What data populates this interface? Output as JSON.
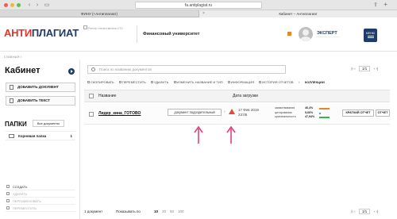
{
  "browser": {
    "url": "fa.antiplagiat.ru",
    "tabs": [
      {
        "label": "ФИНУ (+Антиплагиат)"
      },
      {
        "label": "Кабинет – Антиплагиат"
      }
    ],
    "traffic_colors": [
      "#ee5e55",
      "#f0b83a",
      "#5fc04d"
    ]
  },
  "header": {
    "logo_part1": "АНТИ",
    "logo_part2": "ПЛАГИАТ",
    "sub_logo": "Реестр отечественного ПО",
    "university": "Финансовый университет",
    "user_role": "ЭКСПЕРТ",
    "menu_label": "МЕНЮ"
  },
  "breadcrumb": "ГЛАВНАЯ /",
  "sidebar": {
    "title": "Кабинет",
    "add_document": "ДОБАВИТЬ ДОКУМЕНТ",
    "add_text": "ДОБАВИТЬ ТЕКСТ",
    "folders_title": "ПАПКИ",
    "all_documents": "Все документы",
    "root_folder": "Корневая папка",
    "root_folder_count": "1",
    "actions": [
      {
        "label": "СОЗДАТЬ",
        "enabled": true
      },
      {
        "label": "УДАЛИТЬ",
        "enabled": false
      },
      {
        "label": "ПЕРЕИМЕНОВАТЬ",
        "enabled": false
      },
      {
        "label": "ПЕРЕМЕСТИТЬ",
        "enabled": false
      }
    ]
  },
  "main": {
    "search_placeholder": "Поиск по названию документов",
    "pager": {
      "page": "1/1"
    },
    "toolbar": {
      "copy": "СКОПИРОВАТЬ",
      "move": "ПЕРЕМЕСТИТЬ",
      "delete": "УДАЛИТЬ",
      "rename": "ИЗМЕНИТЬ НАЗВАНИЕ И ТИП",
      "info": "ИНФОРМАЦИЯ",
      "history": "ИСТОРИЯ ОТЧЕТОВ",
      "collections": "КОЛЛЕКЦИИ"
    },
    "table": {
      "col_name": "Название",
      "col_date": "Дата загрузки",
      "rows": [
        {
          "name": "Лидер_кина_ГОТОВО",
          "type": "документ подозрительный",
          "date": "17 Фев 2019",
          "time": "23:05",
          "borrowing_label": "заимствования",
          "borrowing_value": "46,4%",
          "citation_label": "цитирования",
          "citation_value": "5,66%",
          "originality_label": "оригинальность",
          "originality_value": "47,94%",
          "borrowing_fraction": 0.464,
          "citation_fraction": 0.0566,
          "originality_fraction": 0.4794,
          "short_report": "КРАТКИЙ ОТЧЕТ",
          "report": "ОТЧЕТ"
        }
      ]
    },
    "footer": {
      "count": "1 документ",
      "show_label": "Показывать по",
      "options": [
        "10",
        "20",
        "50",
        "100"
      ],
      "selected": "10",
      "page": "1/1"
    }
  },
  "colors": {
    "brand_red": "#e5342b",
    "brand_navy": "#1f3b6b",
    "borrowing": "#e6862a",
    "citation": "#4aa3df",
    "originality": "#39b54a",
    "arrow": "#e0407f"
  }
}
